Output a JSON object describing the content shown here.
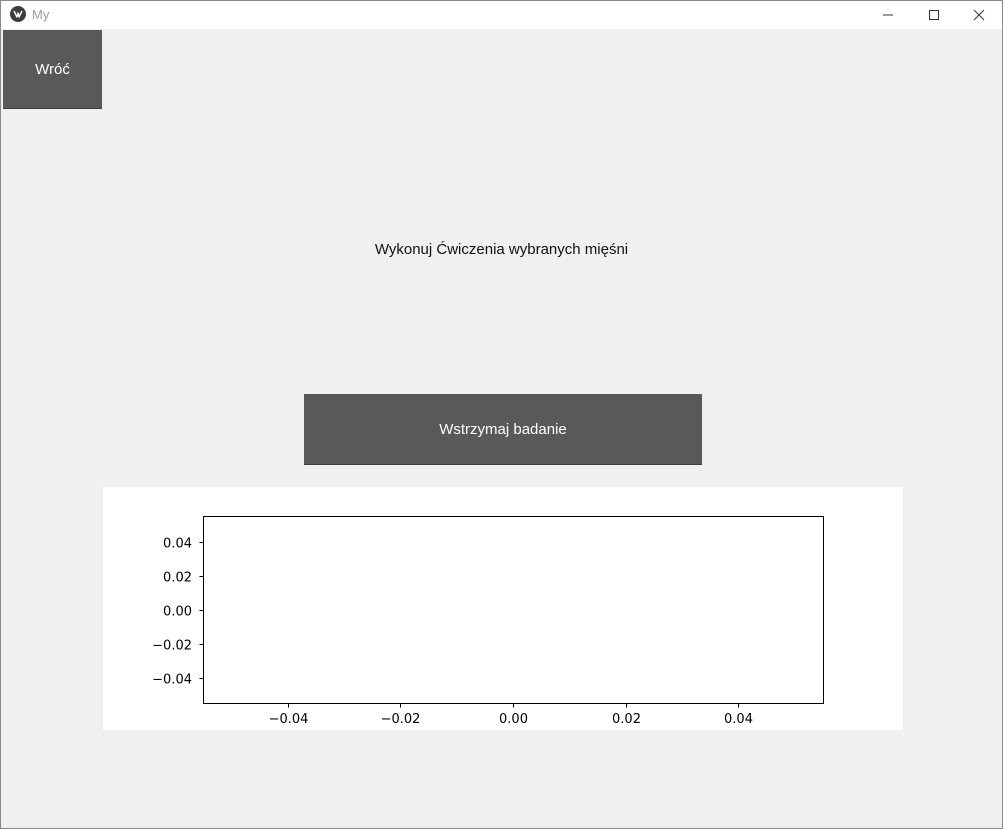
{
  "window": {
    "title": "My"
  },
  "toolbar": {
    "back_label": "Wróć"
  },
  "main": {
    "instruction": "Wykonuj Ćwiczenia wybranych mięśni",
    "pause_label": "Wstrzymaj badanie"
  },
  "chart_data": {
    "type": "line",
    "series": [],
    "xlim": [
      -0.055,
      0.055
    ],
    "ylim": [
      -0.055,
      0.055
    ],
    "xticks": [
      -0.04,
      -0.02,
      0.0,
      0.02,
      0.04
    ],
    "yticks": [
      -0.04,
      -0.02,
      0.0,
      0.02,
      0.04
    ],
    "xtick_labels": [
      "−0.04",
      "−0.02",
      "0.00",
      "0.02",
      "0.04"
    ],
    "ytick_labels": [
      "−0.04",
      "−0.02",
      "0.00",
      "0.02",
      "0.04"
    ],
    "grid": false
  }
}
